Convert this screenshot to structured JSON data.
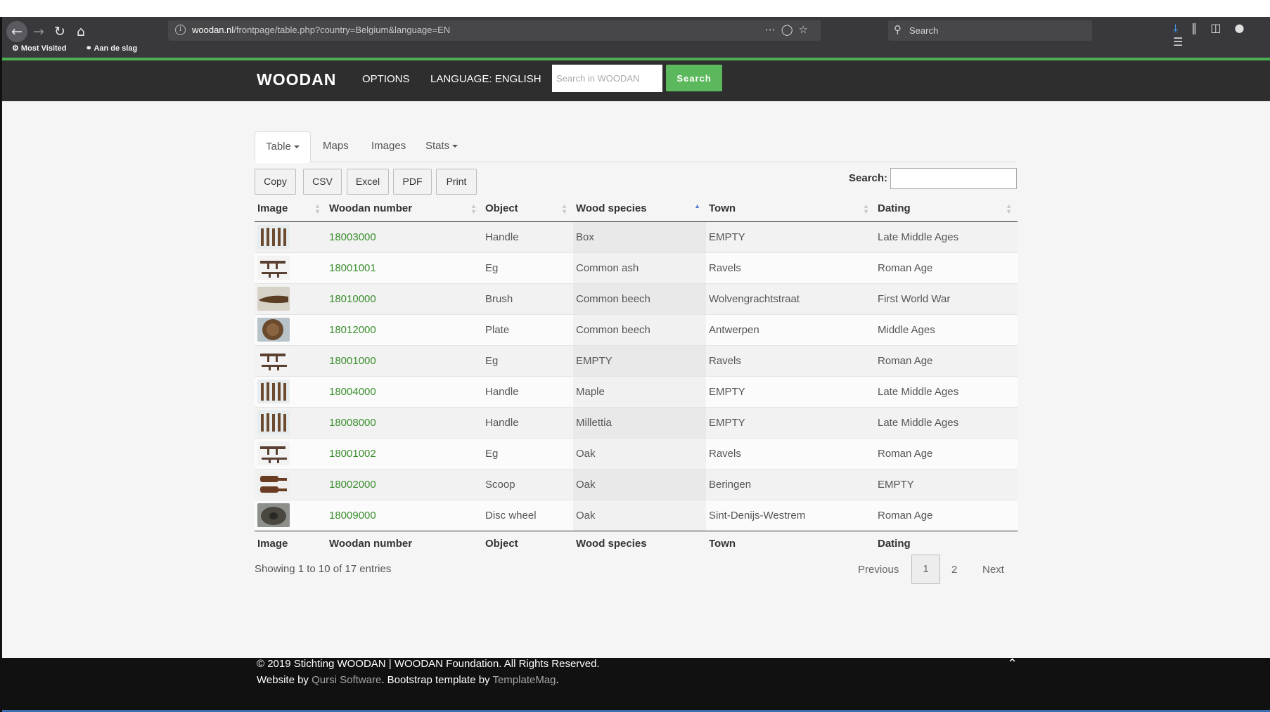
{
  "browser": {
    "url_domain": "woodan.nl",
    "url_path": "/frontpage/table.php?country=Belgium&language=EN",
    "search_placeholder": "Search",
    "bookmarks": [
      "Most Visited",
      "Aan de slag"
    ]
  },
  "header": {
    "logo": "WOODAN",
    "options": "OPTIONS",
    "language": "LANGUAGE: ENGLISH",
    "search_placeholder": "Search in WOODAN",
    "search_button": "Search",
    "accent_color": "#5cb85c"
  },
  "tabs": [
    {
      "label": "Table",
      "active": true
    },
    {
      "label": "Maps"
    },
    {
      "label": "Images"
    },
    {
      "label": "Stats"
    }
  ],
  "export_buttons": [
    "Copy",
    "CSV",
    "Excel",
    "PDF",
    "Print"
  ],
  "table_search_label": "Search:",
  "columns": [
    "Image",
    "Woodan number",
    "Object",
    "Wood species",
    "Town",
    "Dating"
  ],
  "rows": [
    {
      "thumb": "sticks",
      "number": "18003000",
      "object": "Handle",
      "species": "Box",
      "town": "EMPTY",
      "dating": "Late Middle Ages"
    },
    {
      "thumb": "tool",
      "number": "18001001",
      "object": "Eg",
      "species": "Common ash",
      "town": "Ravels",
      "dating": "Roman Age"
    },
    {
      "thumb": "brush",
      "number": "18010000",
      "object": "Brush",
      "species": "Common beech",
      "town": "Wolvengrachtstraat",
      "dating": "First World War"
    },
    {
      "thumb": "plate",
      "number": "18012000",
      "object": "Plate",
      "species": "Common beech",
      "town": "Antwerpen",
      "dating": "Middle Ages"
    },
    {
      "thumb": "tool",
      "number": "18001000",
      "object": "Eg",
      "species": "EMPTY",
      "town": "Ravels",
      "dating": "Roman Age"
    },
    {
      "thumb": "sticks",
      "number": "18004000",
      "object": "Handle",
      "species": "Maple",
      "town": "EMPTY",
      "dating": "Late Middle Ages"
    },
    {
      "thumb": "sticks",
      "number": "18008000",
      "object": "Handle",
      "species": "Millettia",
      "town": "EMPTY",
      "dating": "Late Middle Ages"
    },
    {
      "thumb": "tool",
      "number": "18001002",
      "object": "Eg",
      "species": "Oak",
      "town": "Ravels",
      "dating": "Roman Age"
    },
    {
      "thumb": "scoop",
      "number": "18002000",
      "object": "Scoop",
      "species": "Oak",
      "town": "Beringen",
      "dating": "EMPTY"
    },
    {
      "thumb": "wheel",
      "number": "18009000",
      "object": "Disc wheel",
      "species": "Oak",
      "town": "Sint-Denijs-Westrem",
      "dating": "Roman Age"
    }
  ],
  "info": "Showing 1 to 10 of 17 entries",
  "pagination": {
    "previous": "Previous",
    "pages": [
      "1",
      "2"
    ],
    "current": "1",
    "next": "Next"
  },
  "footer": {
    "copyright": "© 2019 Stichting WOODAN | WOODAN Foundation. All Rights Reserved.",
    "website_by": "Website by",
    "qursi": "Qursi Software",
    "template_by": ". Bootstrap template by",
    "templatemag": "TemplateMag",
    "period": "."
  }
}
